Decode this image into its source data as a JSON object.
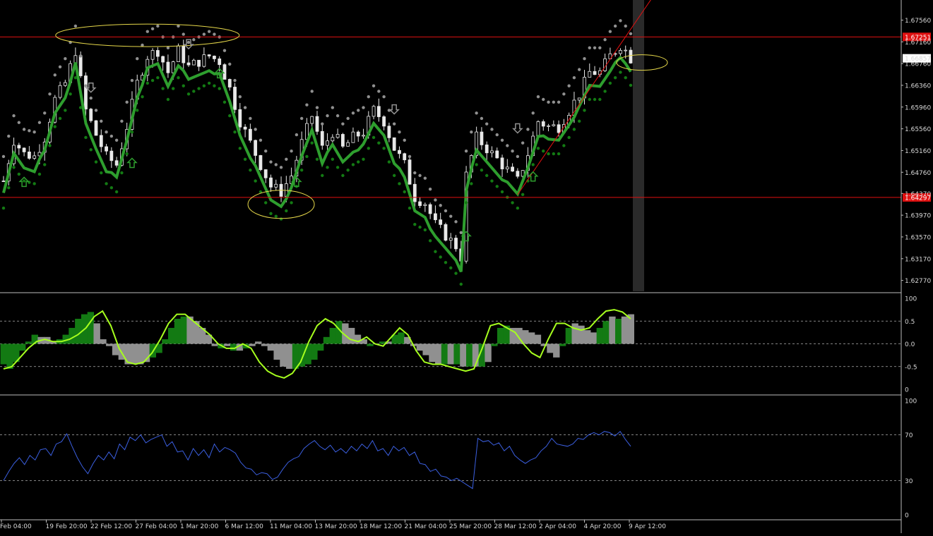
{
  "colors": {
    "background": "#000000",
    "candle": "#e8e8e8",
    "green": "#2e9e2e",
    "green_dark": "#137a13",
    "gray": "#909090",
    "lime": "#a6ff1e",
    "rsi": "#3b5fe0",
    "redline": "#e01010",
    "yellow": "#e6d84a",
    "grid": "#b0b0b0",
    "badge_red": "#e01010",
    "badge_white": "#ffffff"
  },
  "chart_data": [
    {
      "type": "candlestick",
      "panel": "price",
      "price_axis_ticks": [
        "1.67560",
        "1.67160",
        "1.66760",
        "1.66360",
        "1.65960",
        "1.65560",
        "1.65160",
        "1.64760",
        "1.64370",
        "1.63970",
        "1.63570",
        "1.63170",
        "1.62770"
      ],
      "ylim": [
        1.6257,
        1.6793
      ],
      "current_price_label": "1.66857",
      "current_price": 1.66857,
      "horizontal_levels": [
        {
          "value": 1.67251,
          "label": "1.67251"
        },
        {
          "value": 1.64297,
          "label": "1.64297"
        }
      ],
      "trendline": [
        {
          "x": 100,
          "y": 1.6435
        },
        {
          "x": 121,
          "y": 1.6813
        }
      ],
      "close_series": [
        {
          "x": 0,
          "y": 1.646
        },
        {
          "x": 2,
          "y": 1.6535
        },
        {
          "x": 4,
          "y": 1.651
        },
        {
          "x": 6,
          "y": 1.6505
        },
        {
          "x": 8,
          "y": 1.654
        },
        {
          "x": 10,
          "y": 1.661
        },
        {
          "x": 12,
          "y": 1.664
        },
        {
          "x": 14,
          "y": 1.67
        },
        {
          "x": 16,
          "y": 1.659
        },
        {
          "x": 18,
          "y": 1.6545
        },
        {
          "x": 20,
          "y": 1.6505
        },
        {
          "x": 22,
          "y": 1.649
        },
        {
          "x": 24,
          "y": 1.656
        },
        {
          "x": 26,
          "y": 1.664
        },
        {
          "x": 28,
          "y": 1.669
        },
        {
          "x": 30,
          "y": 1.67
        },
        {
          "x": 32,
          "y": 1.666
        },
        {
          "x": 34,
          "y": 1.67
        },
        {
          "x": 36,
          "y": 1.667
        },
        {
          "x": 38,
          "y": 1.668
        },
        {
          "x": 40,
          "y": 1.669
        },
        {
          "x": 42,
          "y": 1.668
        },
        {
          "x": 44,
          "y": 1.663
        },
        {
          "x": 46,
          "y": 1.657
        },
        {
          "x": 48,
          "y": 1.653
        },
        {
          "x": 50,
          "y": 1.649
        },
        {
          "x": 52,
          "y": 1.645
        },
        {
          "x": 54,
          "y": 1.644
        },
        {
          "x": 56,
          "y": 1.647
        },
        {
          "x": 58,
          "y": 1.653
        },
        {
          "x": 60,
          "y": 1.658
        },
        {
          "x": 62,
          "y": 1.652
        },
        {
          "x": 64,
          "y": 1.655
        },
        {
          "x": 66,
          "y": 1.652
        },
        {
          "x": 68,
          "y": 1.654
        },
        {
          "x": 70,
          "y": 1.655
        },
        {
          "x": 72,
          "y": 1.659
        },
        {
          "x": 74,
          "y": 1.657
        },
        {
          "x": 76,
          "y": 1.652
        },
        {
          "x": 78,
          "y": 1.649
        },
        {
          "x": 80,
          "y": 1.643
        },
        {
          "x": 82,
          "y": 1.642
        },
        {
          "x": 84,
          "y": 1.638
        },
        {
          "x": 86,
          "y": 1.636
        },
        {
          "x": 88,
          "y": 1.634
        },
        {
          "x": 89,
          "y": 1.632
        },
        {
          "x": 90,
          "y": 1.647
        },
        {
          "x": 92,
          "y": 1.654
        },
        {
          "x": 94,
          "y": 1.652
        },
        {
          "x": 96,
          "y": 1.65
        },
        {
          "x": 98,
          "y": 1.648
        },
        {
          "x": 100,
          "y": 1.646
        },
        {
          "x": 102,
          "y": 1.651
        },
        {
          "x": 104,
          "y": 1.657
        },
        {
          "x": 106,
          "y": 1.656
        },
        {
          "x": 108,
          "y": 1.656
        },
        {
          "x": 110,
          "y": 1.659
        },
        {
          "x": 112,
          "y": 1.662
        },
        {
          "x": 114,
          "y": 1.666
        },
        {
          "x": 116,
          "y": 1.666
        },
        {
          "x": 118,
          "y": 1.669
        },
        {
          "x": 120,
          "y": 1.671
        },
        {
          "x": 121,
          "y": 1.67
        },
        {
          "x": 122,
          "y": 1.6686
        }
      ]
    },
    {
      "type": "histogram",
      "panel": "oscillator",
      "ylim": [
        -1,
        1
      ],
      "axis_ticks": [
        {
          "value": 1,
          "label": "100"
        },
        {
          "value": 0.5,
          "label": "0.5"
        },
        {
          "value": 0,
          "label": "0.0"
        },
        {
          "value": -0.5,
          "label": "-0.5"
        },
        {
          "value": -1,
          "label": "0"
        }
      ],
      "dashed_levels": [
        0.5,
        0,
        -0.5
      ],
      "bars": [
        -0.45,
        -0.55,
        -0.4,
        -0.15,
        0.05,
        0.2,
        0.15,
        0.15,
        0.05,
        0.1,
        0.2,
        0.35,
        0.55,
        0.65,
        0.7,
        0.45,
        0.1,
        -0.05,
        -0.25,
        -0.35,
        -0.45,
        -0.45,
        -0.45,
        -0.4,
        -0.3,
        -0.2,
        0.1,
        0.35,
        0.55,
        0.6,
        0.6,
        0.5,
        0.35,
        0.2,
        -0.05,
        -0.1,
        -0.05,
        -0.15,
        -0.15,
        -0.1,
        -0.05,
        0.05,
        -0.05,
        -0.15,
        -0.35,
        -0.5,
        -0.55,
        -0.55,
        -0.5,
        -0.45,
        -0.35,
        -0.15,
        0.15,
        0.35,
        0.5,
        0.45,
        0.35,
        0.2,
        0.1,
        -0.05,
        0.0,
        0.05,
        0.05,
        0.2,
        0.25,
        0.15,
        -0.05,
        -0.15,
        -0.25,
        -0.4,
        -0.45,
        -0.45,
        -0.45,
        -0.45,
        -0.5,
        -0.5,
        -0.5,
        -0.5,
        -0.4,
        -0.05,
        0.35,
        0.4,
        0.35,
        0.35,
        0.3,
        0.25,
        0.2,
        -0.05,
        -0.2,
        -0.3,
        -0.05,
        0.35,
        0.45,
        0.4,
        0.3,
        0.25,
        0.35,
        0.5,
        0.6,
        0.55,
        0.6,
        0.65
      ],
      "bar_colors": [
        "green",
        "green",
        "green",
        "green",
        "green",
        "green",
        "gray",
        "gray",
        "gray",
        "green",
        "green",
        "green",
        "green",
        "green",
        "green",
        "gray",
        "gray",
        "gray",
        "gray",
        "gray",
        "gray",
        "gray",
        "gray",
        "gray",
        "green",
        "green",
        "green",
        "green",
        "green",
        "green",
        "gray",
        "gray",
        "gray",
        "gray",
        "gray",
        "green",
        "gray",
        "green",
        "gray",
        "green",
        "gray",
        "gray",
        "gray",
        "gray",
        "gray",
        "gray",
        "gray",
        "green",
        "green",
        "green",
        "green",
        "green",
        "green",
        "green",
        "green",
        "gray",
        "gray",
        "gray",
        "gray",
        "green",
        "gray",
        "green",
        "gray",
        "green",
        "green",
        "gray",
        "gray",
        "gray",
        "gray",
        "gray",
        "gray",
        "green",
        "gray",
        "green",
        "gray",
        "green",
        "gray",
        "green",
        "gray",
        "green",
        "green",
        "green",
        "gray",
        "gray",
        "gray",
        "gray",
        "gray",
        "gray",
        "gray",
        "gray",
        "green",
        "green",
        "gray",
        "gray",
        "gray",
        "gray",
        "green",
        "green",
        "gray",
        "green",
        "gray",
        "gray"
      ],
      "signal_line": [
        -0.55,
        -0.5,
        -0.3,
        -0.1,
        0.05,
        0.1,
        0.05,
        0.05,
        0.1,
        0.2,
        0.35,
        0.6,
        0.72,
        0.4,
        -0.1,
        -0.4,
        -0.45,
        -0.4,
        -0.2,
        0.1,
        0.45,
        0.65,
        0.65,
        0.5,
        0.35,
        0.2,
        0.0,
        -0.1,
        -0.1,
        0.0,
        -0.1,
        -0.4,
        -0.6,
        -0.7,
        -0.75,
        -0.65,
        -0.4,
        0.05,
        0.4,
        0.55,
        0.45,
        0.25,
        0.1,
        0.05,
        0.15,
        0.0,
        -0.05,
        0.15,
        0.35,
        0.2,
        -0.15,
        -0.4,
        -0.45,
        -0.45,
        -0.5,
        -0.55,
        -0.6,
        -0.55,
        -0.1,
        0.4,
        0.45,
        0.35,
        0.25,
        0.0,
        -0.2,
        -0.3,
        0.1,
        0.45,
        0.45,
        0.35,
        0.3,
        0.35,
        0.55,
        0.72,
        0.75,
        0.7,
        0.55
      ]
    },
    {
      "type": "line",
      "panel": "rsi",
      "ylim": [
        0,
        100
      ],
      "axis_ticks": [
        "100",
        "70",
        "30",
        "0"
      ],
      "dashed_levels": [
        70,
        30
      ],
      "values": [
        30,
        38,
        45,
        50,
        44,
        52,
        48,
        57,
        58,
        52,
        62,
        64,
        71,
        60,
        50,
        42,
        36,
        45,
        52,
        48,
        55,
        49,
        62,
        57,
        68,
        65,
        70,
        63,
        66,
        68,
        70,
        60,
        64,
        55,
        56,
        48,
        58,
        52,
        57,
        50,
        62,
        55,
        59,
        57,
        54,
        46,
        41,
        40,
        35,
        37,
        36,
        31,
        33,
        40,
        46,
        49,
        51,
        58,
        62,
        65,
        60,
        57,
        61,
        55,
        58,
        54,
        60,
        56,
        62,
        58,
        65,
        56,
        58,
        52,
        60,
        56,
        59,
        52,
        55,
        45,
        44,
        38,
        40,
        34,
        33,
        30,
        32,
        29,
        26,
        23,
        67,
        64,
        65,
        61,
        63,
        56,
        60,
        52,
        48,
        45,
        48,
        50,
        56,
        60,
        67,
        62,
        61,
        60,
        62,
        67,
        66,
        70,
        72,
        70,
        73,
        72,
        69,
        73,
        66,
        60
      ]
    }
  ],
  "x_axis_labels": [
    "Feb 04:00",
    "19 Feb 20:00",
    "22 Feb 12:00",
    "27 Feb 04:00",
    "1 Mar 20:00",
    "6 Mar 12:00",
    "11 Mar 04:00",
    "13 Mar 20:00",
    "18 Mar 12:00",
    "21 Mar 04:00",
    "25 Mar 20:00",
    "28 Mar 12:00",
    "2 Apr 04:00",
    "4 Apr 20:00",
    "9 Apr 12:00"
  ]
}
